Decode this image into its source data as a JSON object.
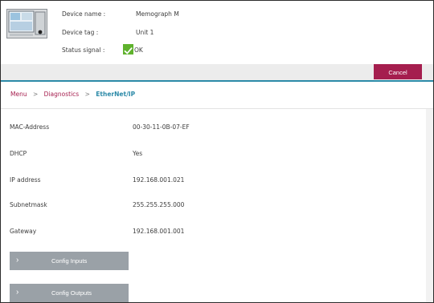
{
  "header": {
    "device_name_label": "Device name :",
    "device_name": "Memograph M",
    "device_tag_label": "Device tag :",
    "device_tag": "Unit 1",
    "status_signal_label": "Status signal :",
    "status_signal_value": "OK"
  },
  "toolbar": {
    "cancel_label": "Cancel"
  },
  "breadcrumb": {
    "menu": "Menu",
    "diagnostics": "Diagnostics",
    "current": "EtherNet/IP",
    "separator": ">"
  },
  "network": {
    "rows": [
      {
        "label": "MAC-Address",
        "value": "00-30-11-0B-07-EF"
      },
      {
        "label": "DHCP",
        "value": "Yes"
      },
      {
        "label": "IP address",
        "value": "192.168.001.021"
      },
      {
        "label": "Subnetmask",
        "value": "255.255.255.000"
      },
      {
        "label": "Gateway",
        "value": "192.168.001.001"
      }
    ]
  },
  "buttons": {
    "config_inputs": "Config Inputs",
    "config_outputs": "Config Outputs"
  },
  "colors": {
    "accent": "#a51e4e",
    "link": "#2c8aa8",
    "status_ok": "#5fb22d",
    "button_gray": "#9aa1a7"
  },
  "icons": {
    "device": "device-thumbnail",
    "status": "checkmark-icon",
    "chevron": "chevron-right-icon"
  }
}
